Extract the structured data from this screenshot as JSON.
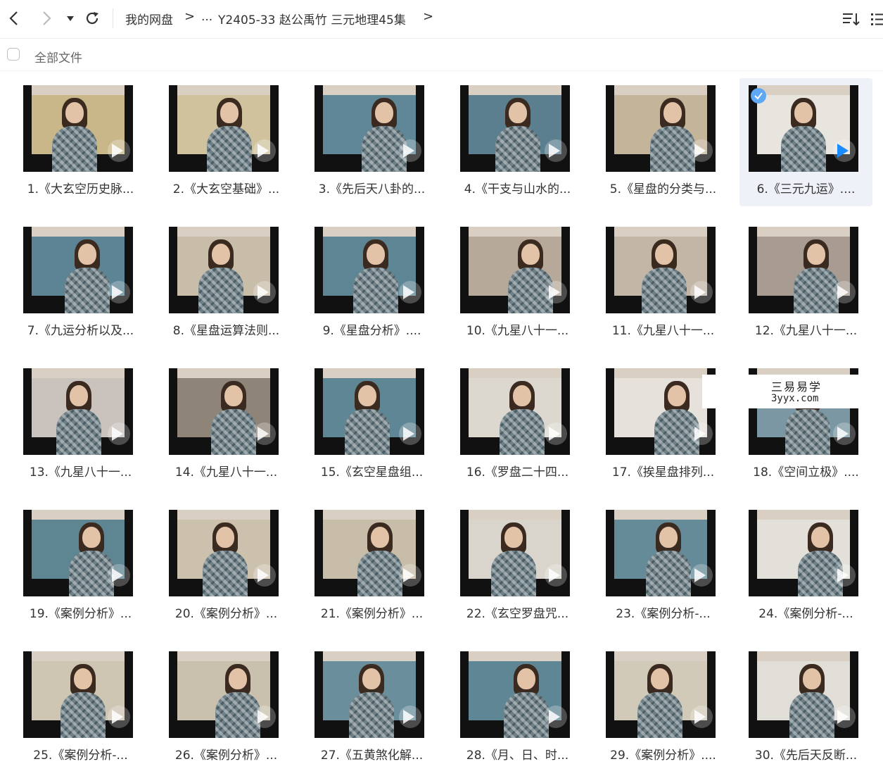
{
  "toolbar": {
    "breadcrumb": {
      "root": "我的网盘",
      "ellipsis": "...",
      "current": "Y2405-33 赵公禹竹 三元地理45集"
    }
  },
  "all_files": {
    "label": "全部文件"
  },
  "watermark": {
    "line1": "三易易学",
    "line2": "3yyx.com"
  },
  "files": [
    {
      "caption": "1.《大玄空历史脉...",
      "selected": false
    },
    {
      "caption": "2.《大玄空基础》...",
      "selected": false
    },
    {
      "caption": "3.《先后天八卦的...",
      "selected": false
    },
    {
      "caption": "4.《干支与山水的...",
      "selected": false
    },
    {
      "caption": "5.《星盘的分类与...",
      "selected": false
    },
    {
      "caption": "6.《三元九运》....",
      "selected": true
    },
    {
      "caption": "7.《九运分析以及...",
      "selected": false
    },
    {
      "caption": "8.《星盘运算法则...",
      "selected": false
    },
    {
      "caption": "9.《星盘分析》....",
      "selected": false
    },
    {
      "caption": "10.《九星八十一...",
      "selected": false
    },
    {
      "caption": "11.《九星八十一...",
      "selected": false
    },
    {
      "caption": "12.《九星八十一...",
      "selected": false
    },
    {
      "caption": "13.《九星八十一...",
      "selected": false
    },
    {
      "caption": "14.《九星八十一...",
      "selected": false
    },
    {
      "caption": "15.《玄空星盘组...",
      "selected": false
    },
    {
      "caption": "16.《罗盘二十四...",
      "selected": false
    },
    {
      "caption": "17.《挨星盘排列...",
      "selected": false
    },
    {
      "caption": "18.《空间立极》....",
      "selected": false
    },
    {
      "caption": "19.《案例分析》...",
      "selected": false
    },
    {
      "caption": "20.《案例分析》...",
      "selected": false
    },
    {
      "caption": "21.《案例分析》...",
      "selected": false
    },
    {
      "caption": "22.《玄空罗盘咒...",
      "selected": false
    },
    {
      "caption": "23.《案例分析-...",
      "selected": false
    },
    {
      "caption": "24.《案例分析-...",
      "selected": false
    },
    {
      "caption": "25.《案例分析-...",
      "selected": false
    },
    {
      "caption": "26.《案例分析》...",
      "selected": false
    },
    {
      "caption": "27.《五黄煞化解...",
      "selected": false
    },
    {
      "caption": "28.《月、日、时...",
      "selected": false
    },
    {
      "caption": "29.《案例分析》....",
      "selected": false
    },
    {
      "caption": "30.《先后天反断...",
      "selected": false
    }
  ],
  "colors": {
    "accent": "#1a8cff",
    "selected_bg": "#eef1f7"
  }
}
